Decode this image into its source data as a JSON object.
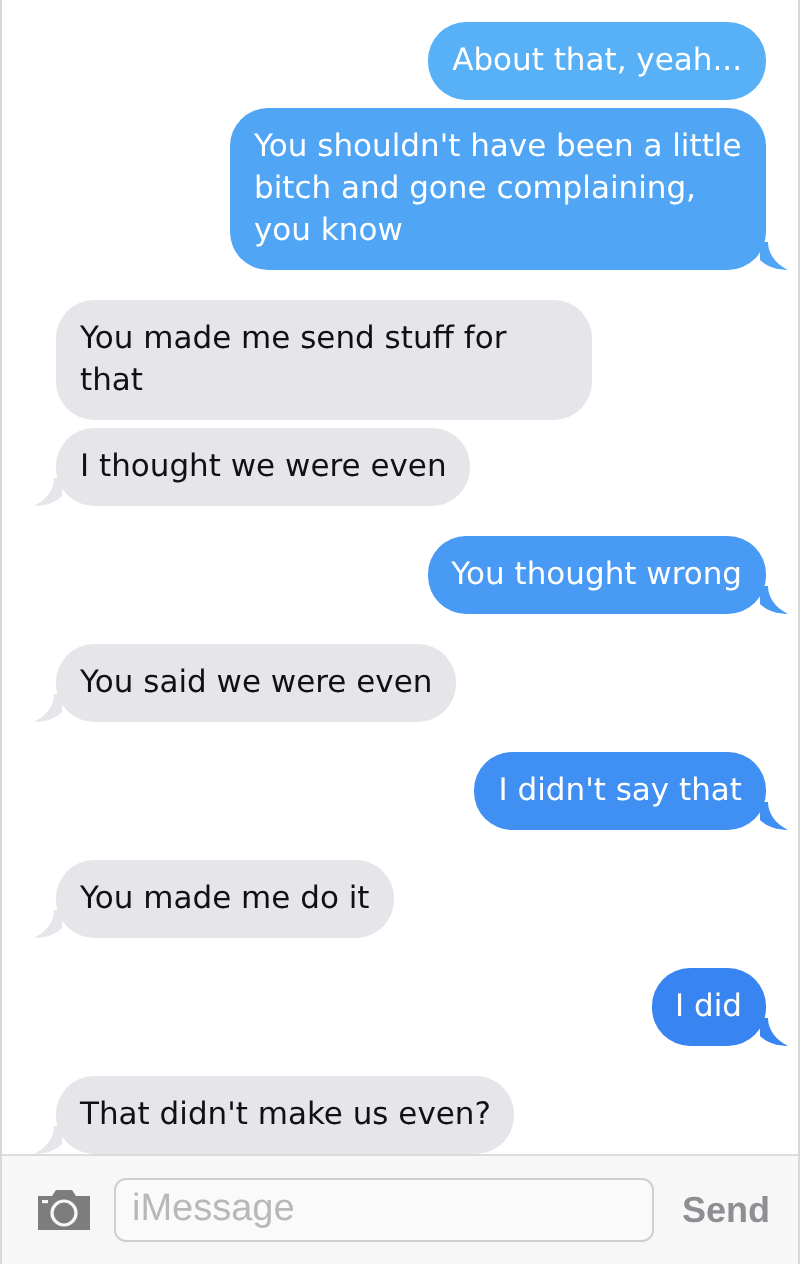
{
  "messages": [
    {
      "kind": "sent",
      "text": "About that, yeah...",
      "tail": false
    },
    {
      "kind": "sent",
      "text": "You shouldn't have been a little bitch and gone complaining, you know",
      "tail": true
    },
    {
      "kind": "received",
      "text": "You made me send stuff for that",
      "tail": false
    },
    {
      "kind": "received",
      "text": "I thought we were even",
      "tail": true
    },
    {
      "kind": "sent",
      "text": "You thought wrong",
      "tail": true
    },
    {
      "kind": "received",
      "text": "You said we were even",
      "tail": true
    },
    {
      "kind": "sent",
      "text": "I didn't say that",
      "tail": true
    },
    {
      "kind": "received",
      "text": "You made me do it",
      "tail": true
    },
    {
      "kind": "sent",
      "text": "I did",
      "tail": true
    },
    {
      "kind": "received",
      "text": "That didn't make us even?",
      "tail": true
    }
  ],
  "composer": {
    "placeholder": "iMessage",
    "send_label": "Send"
  }
}
